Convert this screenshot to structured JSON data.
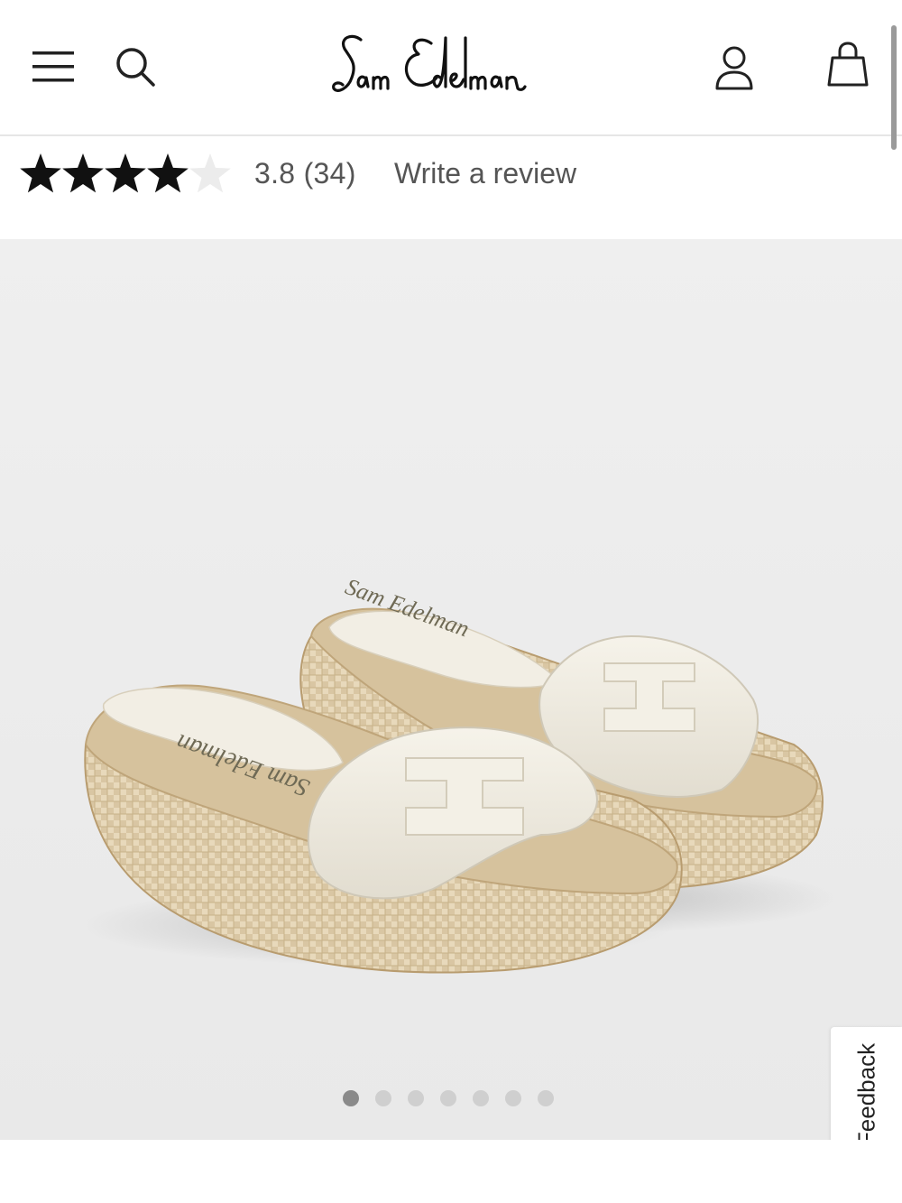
{
  "header": {
    "brand": "Sam Edelman",
    "menu_icon": "hamburger-menu-icon",
    "search_icon": "search-icon",
    "account_icon": "user-account-icon",
    "bag_icon": "shopping-bag-icon"
  },
  "rating": {
    "value": 3.8,
    "text": "3.8 (34)",
    "review_count": 34,
    "stars_filled": 4,
    "stars_total": 5,
    "write_review": "Write a review"
  },
  "product_image": {
    "insole_logo_text": "Sam Edelman"
  },
  "carousel": {
    "slide_count": 7,
    "active_index": 0
  },
  "feedback": {
    "label": "Feedback"
  },
  "colors": {
    "star_filled": "#111111",
    "star_empty": "#ececec",
    "text_muted": "#555555",
    "background": "#ffffff",
    "image_bg": "#ececec"
  }
}
